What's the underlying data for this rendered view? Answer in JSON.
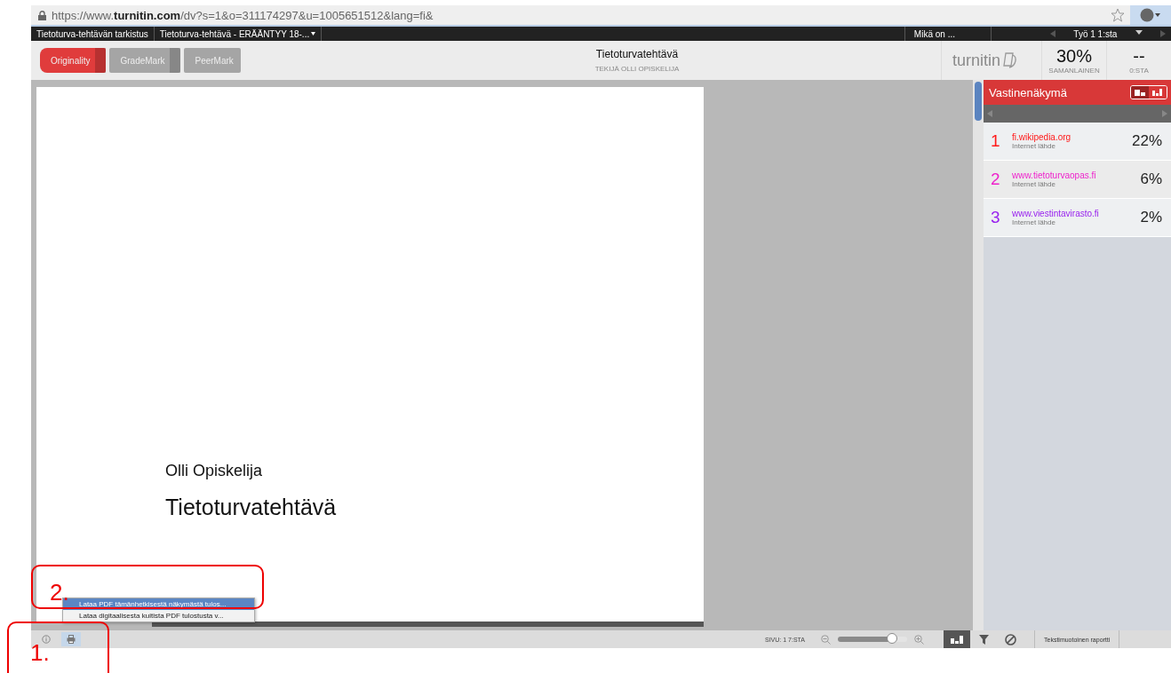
{
  "browser": {
    "url": "https://www.**turnitin.com**/dv?s=1&o=311174297&u=1005651512&lang=fi&"
  },
  "top_bar": {
    "tabs": [
      {
        "label": "Tietoturva-tehtävän tarkistus"
      },
      {
        "label": "Tietoturva-tehtävä - ERÄÄNTYY 18-..."
      }
    ],
    "help": "Mikä on ...",
    "paper": "Työ 1 1:sta"
  },
  "modes": [
    {
      "label": "Originality",
      "selected": true
    },
    {
      "label": "GradeMark",
      "selected": false
    },
    {
      "label": "PeerMark",
      "selected": false
    }
  ],
  "header": {
    "title": "Tietoturvatehtävä",
    "author": "TEKIJÄ OLLI OPISKELIJA",
    "logo": "turnitin",
    "similarity": {
      "value": "30%",
      "label": "SAMANLAINEN"
    },
    "grade": {
      "value": "--",
      "label": "0:STA"
    }
  },
  "document": {
    "author": "Olli Opiskelija",
    "title": "Tietoturvatehtävä"
  },
  "panel": {
    "title": "Vastinenäkymä",
    "views": [
      {
        "kind": "list",
        "selected": true
      },
      {
        "kind": "chart",
        "selected": false
      }
    ],
    "matches": [
      {
        "number": "1",
        "source": "fi.wikipedia.org",
        "type": "Internet lähde",
        "percent": "22%",
        "color": "#ff1a1a"
      },
      {
        "number": "2",
        "source": "www.tietoturvaopas.fi",
        "type": "Internet lähde",
        "percent": "6%",
        "color": "#ee22cc"
      },
      {
        "number": "3",
        "source": "www.viestintavirasto.fi",
        "type": "Internet lähde",
        "percent": "2%",
        "color": "#9922ee"
      }
    ]
  },
  "bottom_bar": {
    "buttons": [
      {
        "kind": "info",
        "selected": false
      },
      {
        "kind": "print",
        "selected": true
      }
    ],
    "page": "SIVU:  1 7:STA",
    "zoom": {
      "level": 0.78
    },
    "tools": [
      {
        "kind": "overview",
        "selected": true
      },
      {
        "kind": "filter",
        "selected": false
      },
      {
        "kind": "exclude",
        "selected": false
      }
    ],
    "text_report": "Tekstimuotoinen raportti"
  },
  "print_menu": {
    "items": [
      {
        "label": "Lataa PDF tämänhetkisestä näkymästä tulos...",
        "selected": true
      },
      {
        "label": "Lataa digitaalisesta kuitista PDF tulostusta v...",
        "selected": false
      }
    ]
  },
  "annotations": [
    {
      "label": "1."
    },
    {
      "label": "2."
    }
  ]
}
